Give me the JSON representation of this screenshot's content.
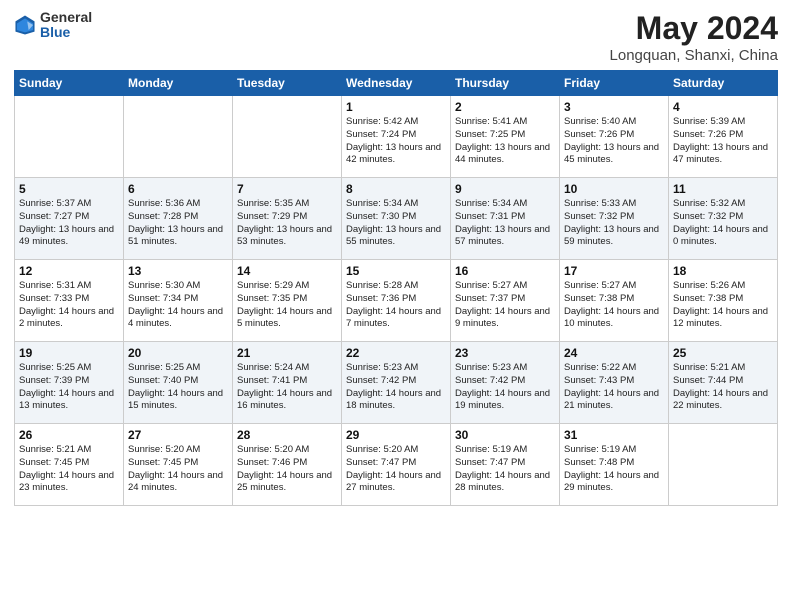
{
  "header": {
    "logo_general": "General",
    "logo_blue": "Blue",
    "title": "May 2024",
    "location": "Longquan, Shanxi, China"
  },
  "days_of_week": [
    "Sunday",
    "Monday",
    "Tuesday",
    "Wednesday",
    "Thursday",
    "Friday",
    "Saturday"
  ],
  "weeks": [
    [
      {
        "day": "",
        "info": ""
      },
      {
        "day": "",
        "info": ""
      },
      {
        "day": "",
        "info": ""
      },
      {
        "day": "1",
        "info": "Sunrise: 5:42 AM\nSunset: 7:24 PM\nDaylight: 13 hours and 42 minutes."
      },
      {
        "day": "2",
        "info": "Sunrise: 5:41 AM\nSunset: 7:25 PM\nDaylight: 13 hours and 44 minutes."
      },
      {
        "day": "3",
        "info": "Sunrise: 5:40 AM\nSunset: 7:26 PM\nDaylight: 13 hours and 45 minutes."
      },
      {
        "day": "4",
        "info": "Sunrise: 5:39 AM\nSunset: 7:26 PM\nDaylight: 13 hours and 47 minutes."
      }
    ],
    [
      {
        "day": "5",
        "info": "Sunrise: 5:37 AM\nSunset: 7:27 PM\nDaylight: 13 hours and 49 minutes."
      },
      {
        "day": "6",
        "info": "Sunrise: 5:36 AM\nSunset: 7:28 PM\nDaylight: 13 hours and 51 minutes."
      },
      {
        "day": "7",
        "info": "Sunrise: 5:35 AM\nSunset: 7:29 PM\nDaylight: 13 hours and 53 minutes."
      },
      {
        "day": "8",
        "info": "Sunrise: 5:34 AM\nSunset: 7:30 PM\nDaylight: 13 hours and 55 minutes."
      },
      {
        "day": "9",
        "info": "Sunrise: 5:34 AM\nSunset: 7:31 PM\nDaylight: 13 hours and 57 minutes."
      },
      {
        "day": "10",
        "info": "Sunrise: 5:33 AM\nSunset: 7:32 PM\nDaylight: 13 hours and 59 minutes."
      },
      {
        "day": "11",
        "info": "Sunrise: 5:32 AM\nSunset: 7:32 PM\nDaylight: 14 hours and 0 minutes."
      }
    ],
    [
      {
        "day": "12",
        "info": "Sunrise: 5:31 AM\nSunset: 7:33 PM\nDaylight: 14 hours and 2 minutes."
      },
      {
        "day": "13",
        "info": "Sunrise: 5:30 AM\nSunset: 7:34 PM\nDaylight: 14 hours and 4 minutes."
      },
      {
        "day": "14",
        "info": "Sunrise: 5:29 AM\nSunset: 7:35 PM\nDaylight: 14 hours and 5 minutes."
      },
      {
        "day": "15",
        "info": "Sunrise: 5:28 AM\nSunset: 7:36 PM\nDaylight: 14 hours and 7 minutes."
      },
      {
        "day": "16",
        "info": "Sunrise: 5:27 AM\nSunset: 7:37 PM\nDaylight: 14 hours and 9 minutes."
      },
      {
        "day": "17",
        "info": "Sunrise: 5:27 AM\nSunset: 7:38 PM\nDaylight: 14 hours and 10 minutes."
      },
      {
        "day": "18",
        "info": "Sunrise: 5:26 AM\nSunset: 7:38 PM\nDaylight: 14 hours and 12 minutes."
      }
    ],
    [
      {
        "day": "19",
        "info": "Sunrise: 5:25 AM\nSunset: 7:39 PM\nDaylight: 14 hours and 13 minutes."
      },
      {
        "day": "20",
        "info": "Sunrise: 5:25 AM\nSunset: 7:40 PM\nDaylight: 14 hours and 15 minutes."
      },
      {
        "day": "21",
        "info": "Sunrise: 5:24 AM\nSunset: 7:41 PM\nDaylight: 14 hours and 16 minutes."
      },
      {
        "day": "22",
        "info": "Sunrise: 5:23 AM\nSunset: 7:42 PM\nDaylight: 14 hours and 18 minutes."
      },
      {
        "day": "23",
        "info": "Sunrise: 5:23 AM\nSunset: 7:42 PM\nDaylight: 14 hours and 19 minutes."
      },
      {
        "day": "24",
        "info": "Sunrise: 5:22 AM\nSunset: 7:43 PM\nDaylight: 14 hours and 21 minutes."
      },
      {
        "day": "25",
        "info": "Sunrise: 5:21 AM\nSunset: 7:44 PM\nDaylight: 14 hours and 22 minutes."
      }
    ],
    [
      {
        "day": "26",
        "info": "Sunrise: 5:21 AM\nSunset: 7:45 PM\nDaylight: 14 hours and 23 minutes."
      },
      {
        "day": "27",
        "info": "Sunrise: 5:20 AM\nSunset: 7:45 PM\nDaylight: 14 hours and 24 minutes."
      },
      {
        "day": "28",
        "info": "Sunrise: 5:20 AM\nSunset: 7:46 PM\nDaylight: 14 hours and 25 minutes."
      },
      {
        "day": "29",
        "info": "Sunrise: 5:20 AM\nSunset: 7:47 PM\nDaylight: 14 hours and 27 minutes."
      },
      {
        "day": "30",
        "info": "Sunrise: 5:19 AM\nSunset: 7:47 PM\nDaylight: 14 hours and 28 minutes."
      },
      {
        "day": "31",
        "info": "Sunrise: 5:19 AM\nSunset: 7:48 PM\nDaylight: 14 hours and 29 minutes."
      },
      {
        "day": "",
        "info": ""
      }
    ]
  ]
}
